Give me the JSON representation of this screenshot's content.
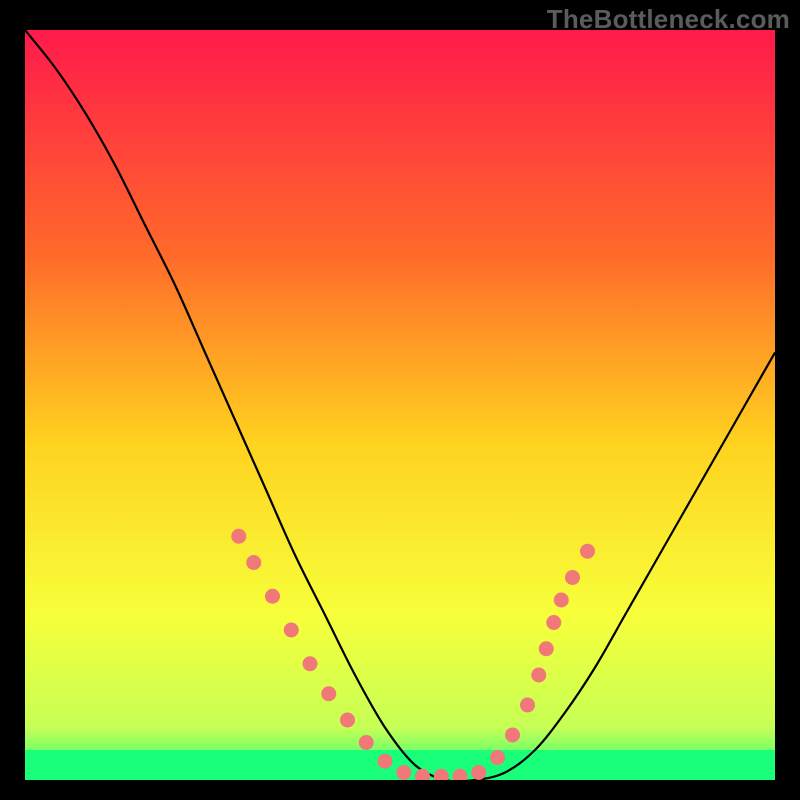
{
  "watermark": "TheBottleneck.com",
  "chart_data": {
    "type": "line",
    "title": "",
    "xlabel": "",
    "ylabel": "",
    "xlim": [
      0,
      100
    ],
    "ylim": [
      0,
      100
    ],
    "gradient_stops": [
      {
        "offset": 0,
        "color": "#ff1a4b"
      },
      {
        "offset": 0.3,
        "color": "#ff6a2a"
      },
      {
        "offset": 0.55,
        "color": "#ffd21f"
      },
      {
        "offset": 0.78,
        "color": "#f7ff3a"
      },
      {
        "offset": 0.93,
        "color": "#c6ff55"
      },
      {
        "offset": 1.0,
        "color": "#19ff7a"
      }
    ],
    "series": [
      {
        "name": "bottleneck-curve",
        "x": [
          0,
          4,
          8,
          12,
          16,
          20,
          24,
          28,
          32,
          36,
          40,
          44,
          48,
          52,
          56,
          60,
          64,
          68,
          72,
          76,
          80,
          84,
          88,
          92,
          96,
          100
        ],
        "y": [
          100,
          95,
          89,
          82,
          74,
          66,
          57,
          48,
          39,
          30,
          22,
          14,
          7,
          2,
          0,
          0,
          1,
          4,
          9,
          15,
          22,
          29,
          36,
          43,
          50,
          57
        ]
      }
    ],
    "dots": {
      "name": "highlight-dots",
      "color": "#f07878",
      "points": [
        {
          "x": 28.5,
          "y": 32.5
        },
        {
          "x": 30.5,
          "y": 29.0
        },
        {
          "x": 33.0,
          "y": 24.5
        },
        {
          "x": 35.5,
          "y": 20.0
        },
        {
          "x": 38.0,
          "y": 15.5
        },
        {
          "x": 40.5,
          "y": 11.5
        },
        {
          "x": 43.0,
          "y": 8.0
        },
        {
          "x": 45.5,
          "y": 5.0
        },
        {
          "x": 48.0,
          "y": 2.5
        },
        {
          "x": 50.5,
          "y": 1.0
        },
        {
          "x": 53.0,
          "y": 0.5
        },
        {
          "x": 55.5,
          "y": 0.5
        },
        {
          "x": 58.0,
          "y": 0.5
        },
        {
          "x": 60.5,
          "y": 1.0
        },
        {
          "x": 63.0,
          "y": 3.0
        },
        {
          "x": 65.0,
          "y": 6.0
        },
        {
          "x": 67.0,
          "y": 10.0
        },
        {
          "x": 68.5,
          "y": 14.0
        },
        {
          "x": 69.5,
          "y": 17.5
        },
        {
          "x": 70.5,
          "y": 21.0
        },
        {
          "x": 71.5,
          "y": 24.0
        },
        {
          "x": 73.0,
          "y": 27.0
        },
        {
          "x": 75.0,
          "y": 30.5
        }
      ]
    },
    "green_band": {
      "y0": 0,
      "y1": 4
    }
  }
}
